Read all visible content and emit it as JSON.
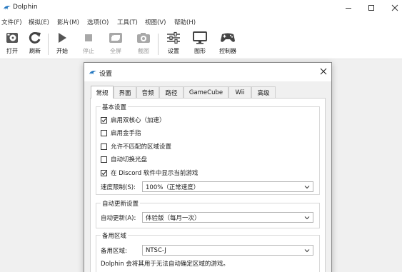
{
  "window": {
    "title": "Dolphin",
    "accent_color": "#1e73be"
  },
  "menu": [
    {
      "label": "文件(F)"
    },
    {
      "label": "模拟(E)"
    },
    {
      "label": "影片(M)"
    },
    {
      "label": "选项(O)"
    },
    {
      "label": "工具(T)"
    },
    {
      "label": "视图(V)"
    },
    {
      "label": "帮助(H)"
    }
  ],
  "toolbar": {
    "open_label": "打开",
    "refresh_label": "刷新",
    "play_label": "开始",
    "stop_label": "停止",
    "fullscreen_label": "全屏",
    "screenshot_label": "截图",
    "config_label": "设置",
    "graphics_label": "图形",
    "controllers_label": "控制器"
  },
  "dialog": {
    "title": "设置",
    "tabs": [
      {
        "label": "常规",
        "active": true
      },
      {
        "label": "界面"
      },
      {
        "label": "音频"
      },
      {
        "label": "路径"
      },
      {
        "label": "GameCube"
      },
      {
        "label": "Wii"
      },
      {
        "label": "高级"
      }
    ],
    "basic": {
      "title": "基本设置",
      "options": [
        {
          "label": "启用双核心（加速）",
          "checked": true
        },
        {
          "label": "启用金手指",
          "checked": false
        },
        {
          "label": "允许不匹配的区域设置",
          "checked": false
        },
        {
          "label": "自动切换光盘",
          "checked": false
        },
        {
          "label": "在 Discord 软件中显示当前游戏",
          "checked": true
        }
      ],
      "speed_label": "速度限制(S):",
      "speed_value": "100%（正常速度）"
    },
    "auto_update": {
      "title": "自动更新设置",
      "label": "自动更新(A):",
      "value": "体验版（每月一次）"
    },
    "fallback": {
      "title": "备用区域",
      "label": "备用区域:",
      "value": "NTSC-J",
      "note": "Dolphin 会将其用于无法自动确定区域的游戏。"
    }
  }
}
